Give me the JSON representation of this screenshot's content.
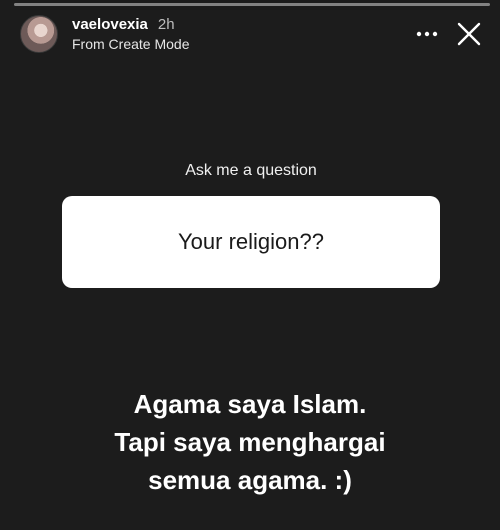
{
  "story": {
    "username": "vaelovexia",
    "time": "2h",
    "subtitle": "From Create Mode",
    "icons": {
      "more": "more-horizontal-icon",
      "close": "close-icon"
    }
  },
  "sticker": {
    "prompt": "Ask me a question",
    "question": "Your religion??"
  },
  "answer": {
    "lines": [
      "Agama saya Islam.",
      "Tapi saya menghargai",
      "semua agama. :)"
    ]
  },
  "colors": {
    "background": "#1c1c1c",
    "sticker_body": "#ffffff",
    "text": "#ffffff"
  }
}
